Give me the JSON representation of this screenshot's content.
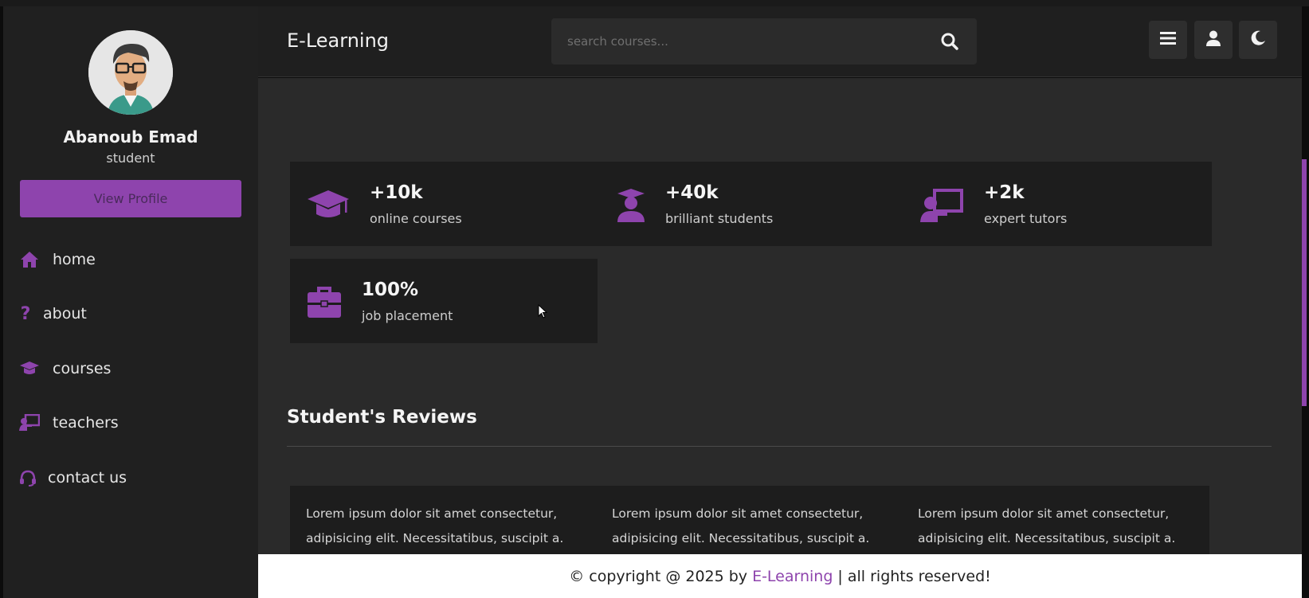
{
  "sidebar": {
    "profile": {
      "name": "Abanoub Emad",
      "role": "student",
      "button": "View Profile"
    },
    "nav": [
      {
        "label": "home",
        "icon": "home-icon"
      },
      {
        "label": "about",
        "icon": "question-icon"
      },
      {
        "label": "courses",
        "icon": "graduation-cap-icon"
      },
      {
        "label": "teachers",
        "icon": "teacher-board-icon"
      },
      {
        "label": "contact us",
        "icon": "headset-icon"
      }
    ]
  },
  "header": {
    "brand": "E-Learning",
    "search_placeholder": "search courses...",
    "buttons": [
      "menu-icon",
      "user-icon",
      "moon-icon"
    ]
  },
  "stats": [
    {
      "value": "+10k",
      "label": "online courses",
      "icon": "graduation-cap-icon"
    },
    {
      "value": "+40k",
      "label": "brilliant students",
      "icon": "student-icon"
    },
    {
      "value": "+2k",
      "label": "expert tutors",
      "icon": "teacher-board-icon"
    },
    {
      "value": "100%",
      "label": "job placement",
      "icon": "briefcase-icon"
    }
  ],
  "reviews": {
    "title": "Student's Reviews",
    "items": [
      {
        "text": "Lorem ipsum dolor sit amet consectetur, adipisicing elit. Necessitatibus, suscipit a."
      },
      {
        "text": "Lorem ipsum dolor sit amet consectetur, adipisicing elit. Necessitatibus, suscipit a."
      },
      {
        "text": "Lorem ipsum dolor sit amet consectetur, adipisicing elit. Necessitatibus, suscipit a."
      }
    ]
  },
  "footer": {
    "prefix": "© copyright @ 2025 by",
    "brand": "E-Learning",
    "suffix": "| all rights reserved!"
  },
  "colors": {
    "accent": "#8e44ad",
    "sidebar": "#202020",
    "content": "#2a2a2a",
    "card": "#1d1d1d"
  }
}
